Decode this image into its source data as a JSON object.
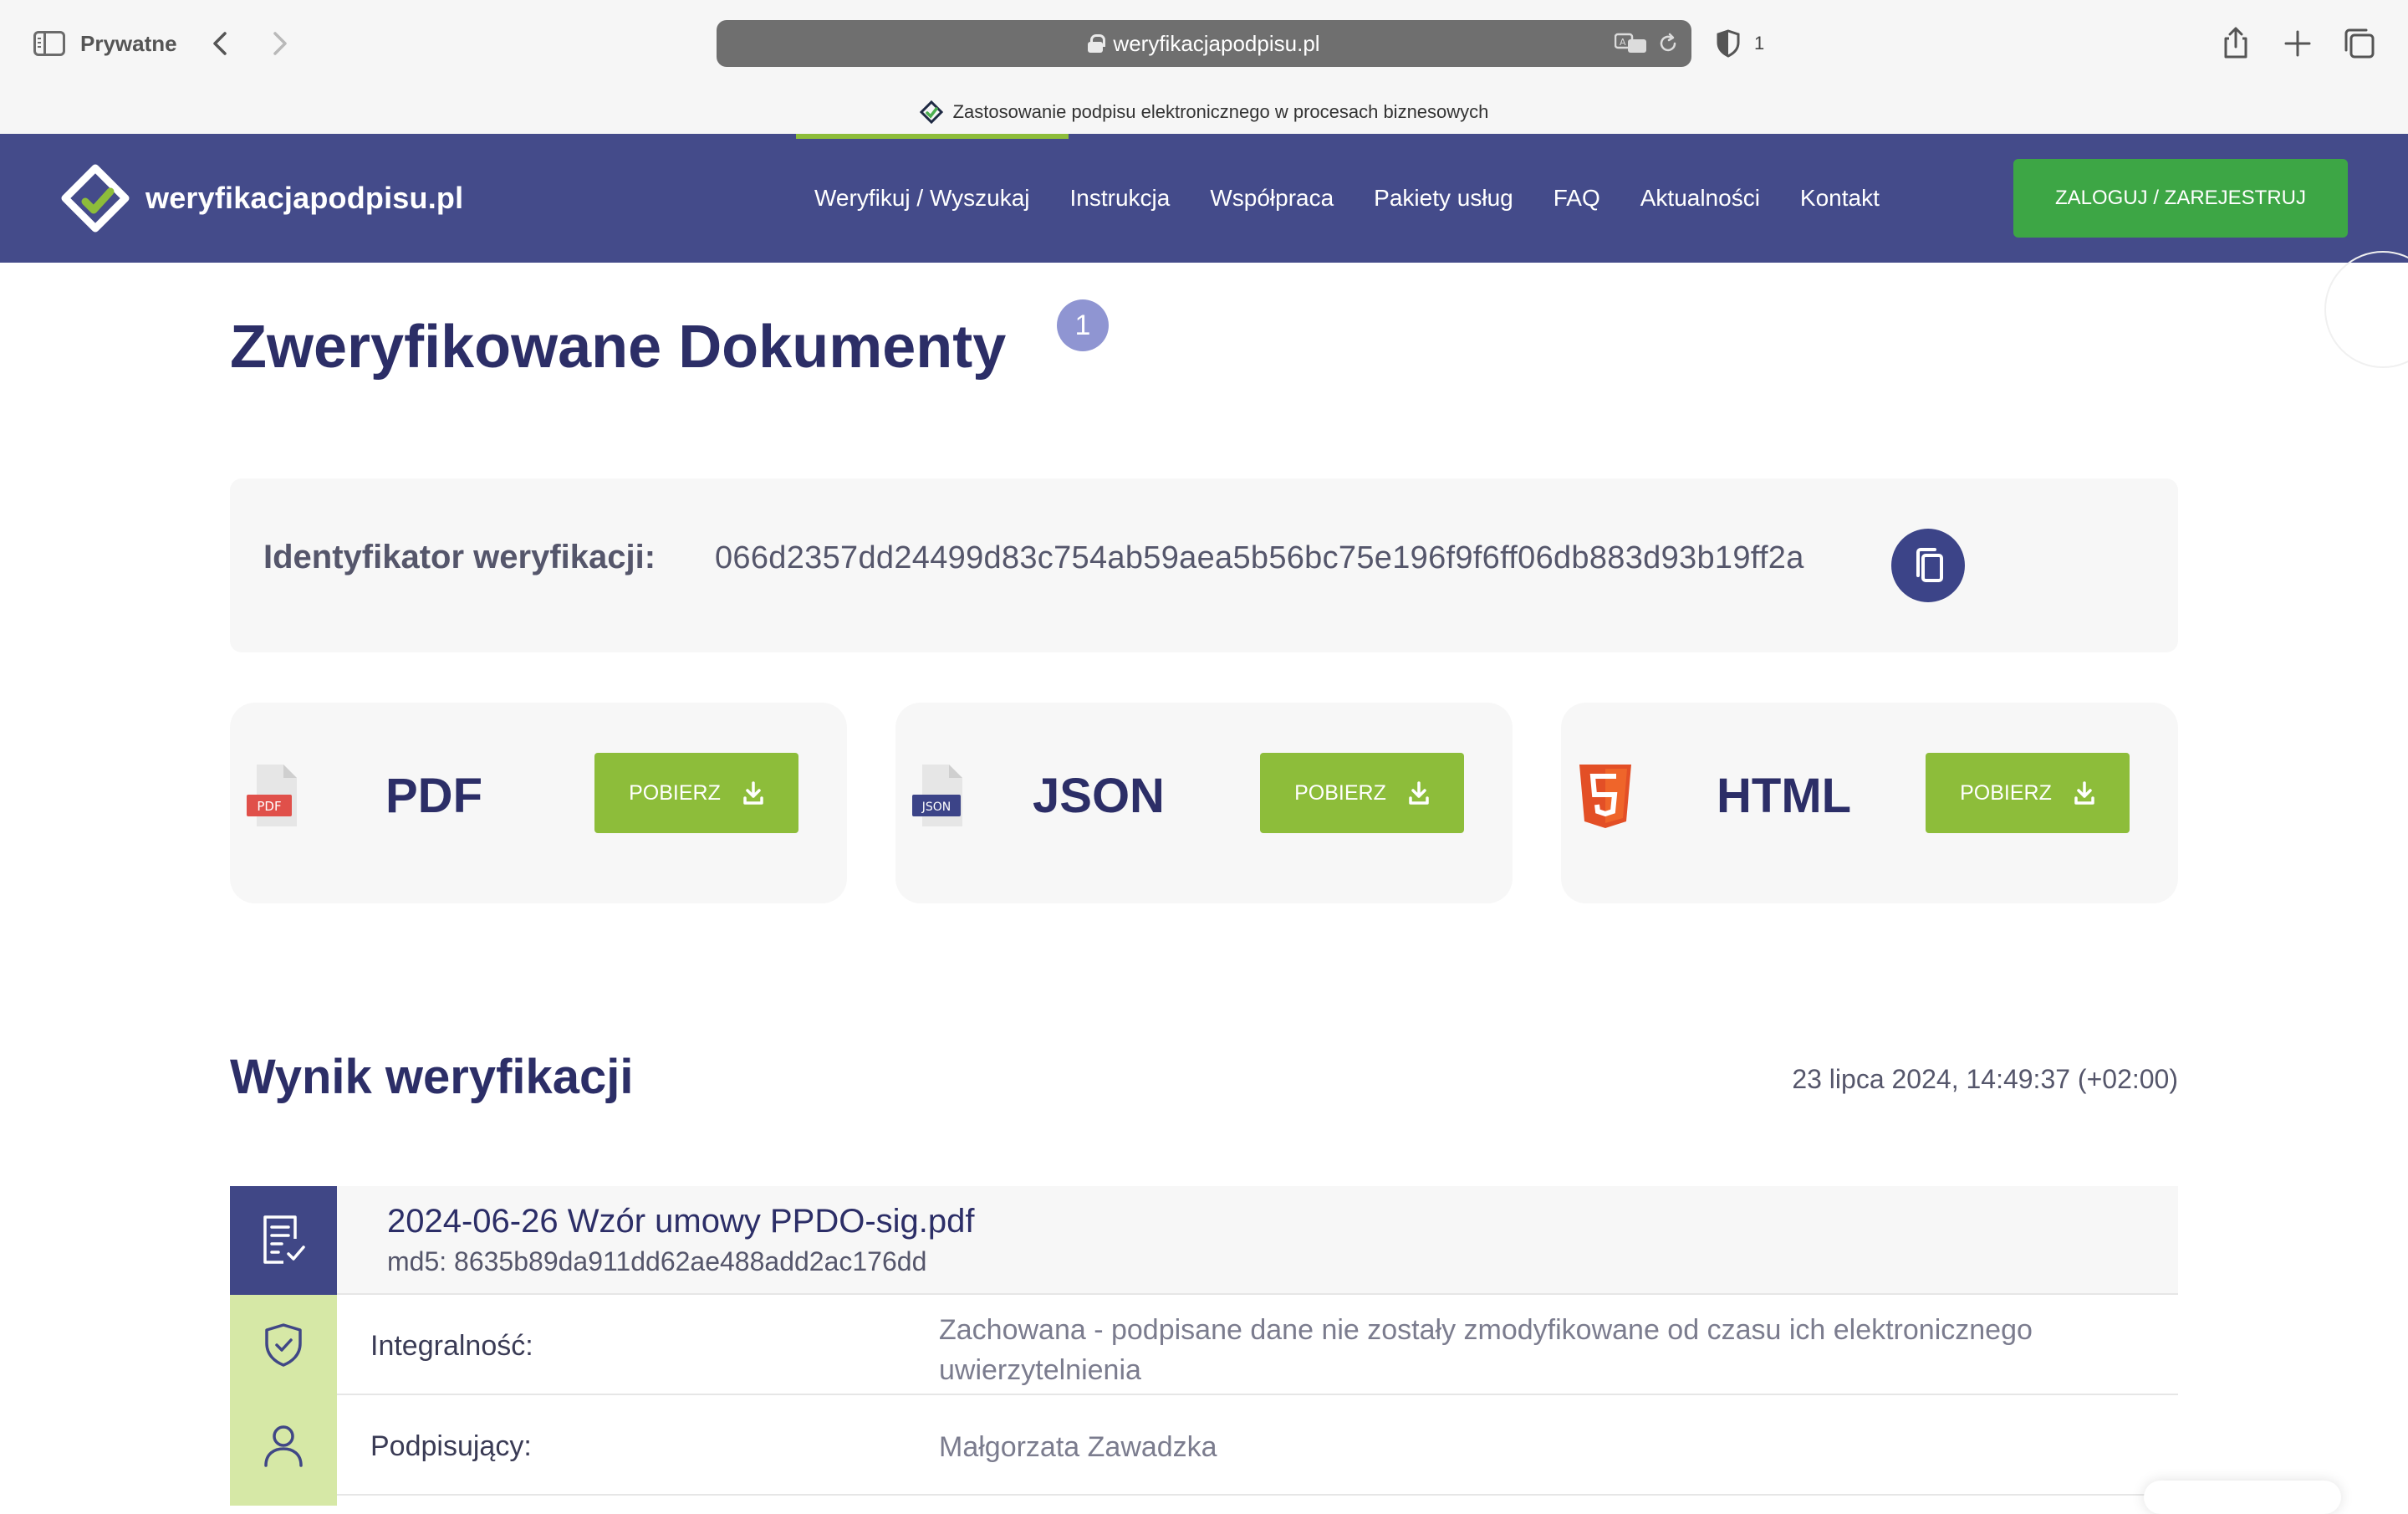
{
  "browser": {
    "private_label": "Prywatne",
    "url": "weryfikacjapodpisu.pl",
    "shield_count": "1",
    "tab_title": "Zastosowanie podpisu elektronicznego w procesach biznesowych"
  },
  "site": {
    "logo_text": "weryfikacjapodpisu.pl",
    "nav": [
      "Weryfikuj / Wyszukaj",
      "Instrukcja",
      "Współpraca",
      "Pakiety usług",
      "FAQ",
      "Aktualności",
      "Kontakt"
    ],
    "login_label": "ZALOGUJ / ZAREJESTRUJ",
    "colors": {
      "header": "#444b8a",
      "accent_green": "#8dbd3a",
      "login_green": "#3da645",
      "title_navy": "#2c2e67"
    }
  },
  "main": {
    "title_bold": "Zweryfikowane",
    "title_regular": "Dokumenty",
    "title_badge": "1",
    "verification_id_label": "Identyfikator weryfikacji:",
    "verification_id": "066d2357dd24499d83c754ab59aea5b56bc75e196f9f6ff06db883d93b19ff2a",
    "downloads": [
      {
        "format": "PDF",
        "button": "POBIERZ",
        "icon": "pdf-file-icon"
      },
      {
        "format": "JSON",
        "button": "POBIERZ",
        "icon": "json-file-icon"
      },
      {
        "format": "HTML",
        "button": "POBIERZ",
        "icon": "html5-icon"
      }
    ]
  },
  "result": {
    "title": "Wynik weryfikacji",
    "date": "23 lipca 2024, 14:49:37 (+02:00)",
    "file_name": "2024-06-26 Wzór umowy PPDO-sig.pdf",
    "md5": "md5: 8635b89da911dd62ae488add2ac176dd",
    "rows": [
      {
        "label": "Integralność:",
        "value": "Zachowana - podpisane dane nie zostały zmodyfikowane od czasu ich elektronicznego uwierzytelnienia",
        "icon": "shield-check-icon"
      },
      {
        "label": "Podpisujący:",
        "value": "Małgorzata Zawadzka",
        "icon": "user-icon"
      }
    ]
  }
}
